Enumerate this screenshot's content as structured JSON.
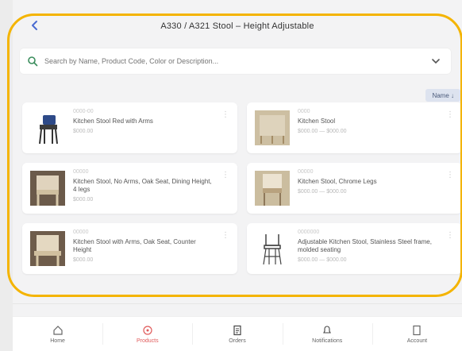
{
  "header": {
    "title": "A330 / A321 Stool – Height Adjustable"
  },
  "search": {
    "placeholder": "Search by Name, Product Code, Color or Description..."
  },
  "sort": {
    "label": "Name ↓"
  },
  "products": [
    {
      "code": "0000-00",
      "name": "Kitchen Stool Red with Arms",
      "price": "$000.00"
    },
    {
      "code": "0000",
      "name": "Kitchen Stool",
      "price": "$000.00 — $000.00"
    },
    {
      "code": "00000",
      "name": "Kitchen Stool, No Arms, Oak Seat, Dining Height, 4 legs",
      "price": "$000.00"
    },
    {
      "code": "00000",
      "name": "Kitchen Stool, Chrome Legs",
      "price": "$000.00 — $000.00"
    },
    {
      "code": "00000",
      "name": "Kitchen Stool with Arms, Oak Seat, Counter Height",
      "price": "$000.00"
    },
    {
      "code": "0000000",
      "name": "Adjustable Kitchen Stool, Stainless Steel frame, molded seating",
      "price": "$000.00 — $000.00"
    }
  ],
  "tabs": [
    {
      "label": "Home",
      "icon": "home-icon"
    },
    {
      "label": "Products",
      "icon": "products-icon",
      "active": true
    },
    {
      "label": "Orders",
      "icon": "document-icon"
    },
    {
      "label": "Notifications",
      "icon": "notification-icon"
    },
    {
      "label": "Account",
      "icon": "account-icon"
    }
  ],
  "colors": {
    "highlight": "#f4b400",
    "accent": "#4a6bd1",
    "active_tab": "#e05a5a"
  }
}
